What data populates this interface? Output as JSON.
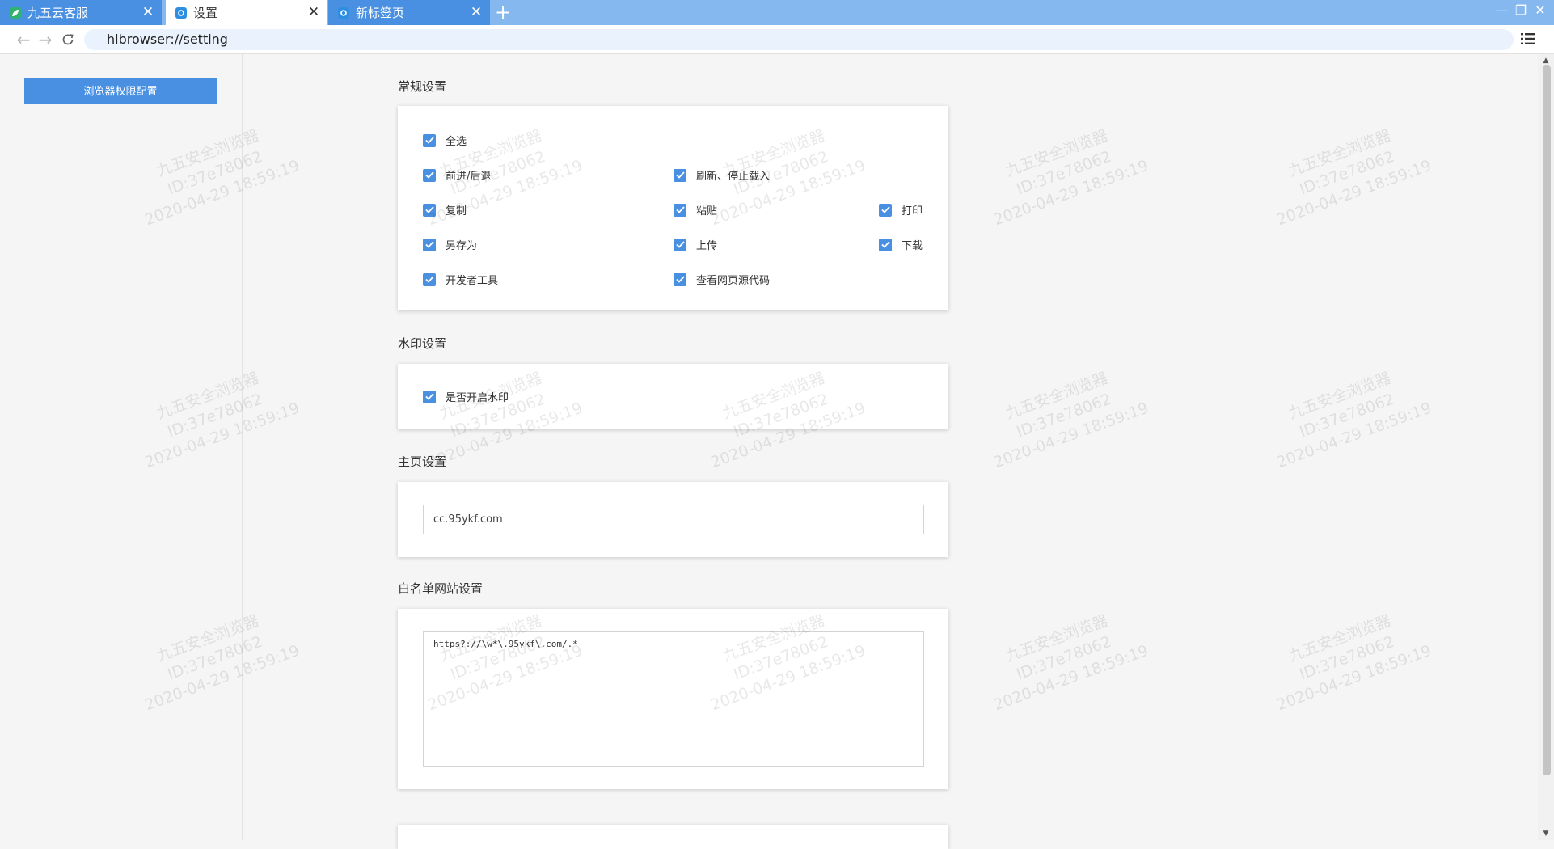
{
  "browser": {
    "tabs": [
      {
        "label": "九五云客服",
        "active": false
      },
      {
        "label": "设置",
        "active": true
      },
      {
        "label": "新标签页",
        "active": false
      }
    ],
    "url": "hlbrowser://setting",
    "colors": {
      "accent": "#4a90e2",
      "tabstrip": "#86b8f0"
    }
  },
  "sidebar": {
    "button_label": "浏览器权限配置"
  },
  "sections": {
    "general": {
      "title": "常规设置",
      "options": [
        {
          "label": "全选",
          "checked": true
        },
        {
          "label": "前进/后退",
          "checked": true
        },
        {
          "label": "刷新、停止载入",
          "checked": true
        },
        {
          "label": "复制",
          "checked": true
        },
        {
          "label": "粘贴",
          "checked": true
        },
        {
          "label": "打印",
          "checked": true
        },
        {
          "label": "另存为",
          "checked": true
        },
        {
          "label": "上传",
          "checked": true
        },
        {
          "label": "下载",
          "checked": true
        },
        {
          "label": "开发者工具",
          "checked": true
        },
        {
          "label": "查看网页源代码",
          "checked": true
        }
      ]
    },
    "watermark": {
      "title": "水印设置",
      "option": {
        "label": "是否开启水印",
        "checked": true
      }
    },
    "homepage": {
      "title": "主页设置",
      "value": "cc.95ykf.com"
    },
    "whitelist": {
      "title": "白名单网站设置",
      "value": "https?://\\w*\\.95ykf\\.com/.*"
    }
  },
  "watermark_overlay": {
    "line1": "九五安全浏览器",
    "line2": "ID:37e78062",
    "line3": "2020-04-29 18:59:19"
  }
}
